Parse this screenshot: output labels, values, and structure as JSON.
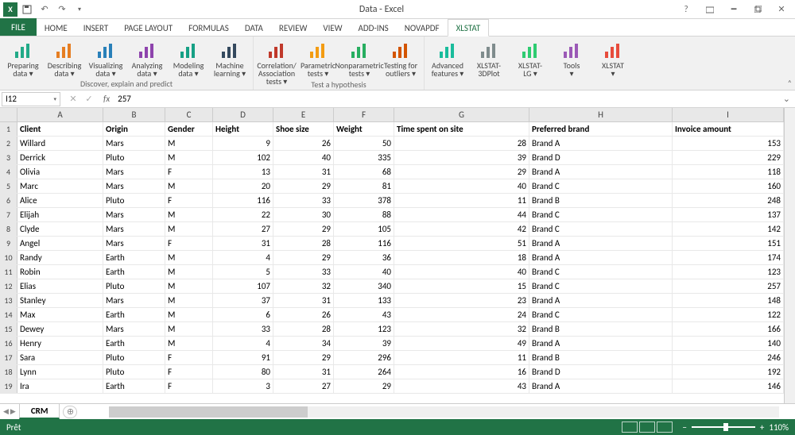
{
  "title": "Data - Excel",
  "tabs": [
    "FILE",
    "HOME",
    "INSERT",
    "PAGE LAYOUT",
    "FORMULAS",
    "DATA",
    "REVIEW",
    "VIEW",
    "ADD-INS",
    "novaPDF",
    "XLSTAT"
  ],
  "active_tab": "XLSTAT",
  "ribbon": {
    "group1_label": "Discover, explain and predict",
    "group1": [
      {
        "label": "Preparing",
        "sub": "data ▾"
      },
      {
        "label": "Describing",
        "sub": "data ▾"
      },
      {
        "label": "Visualizing",
        "sub": "data ▾"
      },
      {
        "label": "Analyzing",
        "sub": "data ▾"
      },
      {
        "label": "Modeling",
        "sub": "data ▾"
      },
      {
        "label": "Machine",
        "sub": "learning ▾"
      }
    ],
    "group2_label": "Test a hypothesis",
    "group2": [
      {
        "label": "Correlation/",
        "sub": "Association tests ▾"
      },
      {
        "label": "Parametric",
        "sub": "tests ▾"
      },
      {
        "label": "Nonparametric",
        "sub": "tests ▾"
      },
      {
        "label": "Testing for",
        "sub": "outliers ▾"
      }
    ],
    "group3": [
      {
        "label": "Advanced",
        "sub": "features ▾"
      },
      {
        "label": "XLSTAT-3DPlot",
        "sub": ""
      },
      {
        "label": "XLSTAT-",
        "sub": "LG ▾"
      },
      {
        "label": "Tools",
        "sub": "▾"
      },
      {
        "label": "XLSTAT",
        "sub": "▾"
      }
    ]
  },
  "namebox": "I12",
  "formula": "257",
  "fx_label": "fx",
  "columns": [
    "A",
    "B",
    "C",
    "D",
    "E",
    "F",
    "G",
    "H",
    "I"
  ],
  "headers": [
    "Client",
    "Origin",
    "Gender",
    "Height",
    "Shoe size",
    "Weight",
    "Time spent on site",
    "Preferred brand",
    "Invoice amount"
  ],
  "data": [
    [
      "Willard",
      "Mars",
      "M",
      "9",
      "26",
      "50",
      "28",
      "Brand A",
      "153"
    ],
    [
      "Derrick",
      "Pluto",
      "M",
      "102",
      "40",
      "335",
      "39",
      "Brand D",
      "229"
    ],
    [
      "Olivia",
      "Mars",
      "F",
      "13",
      "31",
      "68",
      "29",
      "Brand A",
      "118"
    ],
    [
      "Marc",
      "Mars",
      "M",
      "20",
      "29",
      "81",
      "40",
      "Brand C",
      "160"
    ],
    [
      "Alice",
      "Pluto",
      "F",
      "116",
      "33",
      "378",
      "11",
      "Brand B",
      "248"
    ],
    [
      "Elijah",
      "Mars",
      "M",
      "22",
      "30",
      "88",
      "44",
      "Brand C",
      "137"
    ],
    [
      "Clyde",
      "Mars",
      "M",
      "27",
      "29",
      "105",
      "42",
      "Brand C",
      "142"
    ],
    [
      "Angel",
      "Mars",
      "F",
      "31",
      "28",
      "116",
      "51",
      "Brand A",
      "151"
    ],
    [
      "Randy",
      "Earth",
      "M",
      "4",
      "29",
      "36",
      "18",
      "Brand A",
      "174"
    ],
    [
      "Robin",
      "Earth",
      "M",
      "5",
      "33",
      "40",
      "40",
      "Brand C",
      "123"
    ],
    [
      "Elias",
      "Pluto",
      "M",
      "107",
      "32",
      "340",
      "15",
      "Brand C",
      "257"
    ],
    [
      "Stanley",
      "Mars",
      "M",
      "37",
      "31",
      "133",
      "23",
      "Brand A",
      "148"
    ],
    [
      "Max",
      "Earth",
      "M",
      "6",
      "26",
      "43",
      "24",
      "Brand C",
      "122"
    ],
    [
      "Dewey",
      "Mars",
      "M",
      "33",
      "28",
      "123",
      "32",
      "Brand B",
      "166"
    ],
    [
      "Henry",
      "Earth",
      "M",
      "4",
      "34",
      "39",
      "49",
      "Brand A",
      "140"
    ],
    [
      "Sara",
      "Pluto",
      "F",
      "91",
      "29",
      "296",
      "11",
      "Brand B",
      "246"
    ],
    [
      "Lynn",
      "Pluto",
      "F",
      "80",
      "31",
      "264",
      "16",
      "Brand D",
      "192"
    ],
    [
      "Ira",
      "Earth",
      "F",
      "3",
      "27",
      "29",
      "43",
      "Brand A",
      "146"
    ]
  ],
  "numeric_cols": [
    3,
    4,
    5,
    6,
    8
  ],
  "sheet_tab": "CRM",
  "status_ready": "Prêt",
  "zoom": "110%",
  "zoom_plus": "+",
  "zoom_minus": "−"
}
